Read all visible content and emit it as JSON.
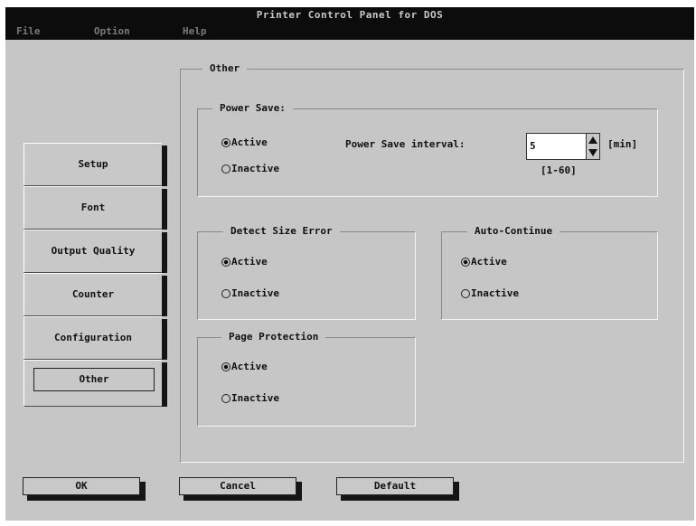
{
  "window": {
    "title": "Printer Control Panel for DOS"
  },
  "menu": [
    "File",
    "Option",
    "Help"
  ],
  "tabs": [
    "Setup",
    "Font",
    "Output Quality",
    "Counter",
    "Configuration",
    "Other"
  ],
  "panel": {
    "title": "Other",
    "power_save": {
      "title": "Power Save:",
      "options": [
        "Active",
        "Inactive"
      ],
      "selected": "Active",
      "interval_label": "Power Save interval:",
      "interval_value": "5",
      "unit": "[min]",
      "range": "[1-60]"
    },
    "detect_size_error": {
      "title": "Detect Size Error",
      "options": [
        "Active",
        "Inactive"
      ],
      "selected": "Active"
    },
    "auto_continue": {
      "title": "Auto-Continue",
      "options": [
        "Active",
        "Inactive"
      ],
      "selected": "Active"
    },
    "page_protection": {
      "title": "Page Protection",
      "options": [
        "Active",
        "Inactive"
      ],
      "selected": "Active"
    }
  },
  "buttons": {
    "ok": "OK",
    "cancel": "Cancel",
    "default": "Default"
  },
  "colors": {
    "window_bg": "#c6c6c6",
    "titlebar": "#0c0c0c",
    "title_text": "#c9c9c9",
    "menu_text": "#7a7a7a",
    "shadow": "#151515"
  }
}
